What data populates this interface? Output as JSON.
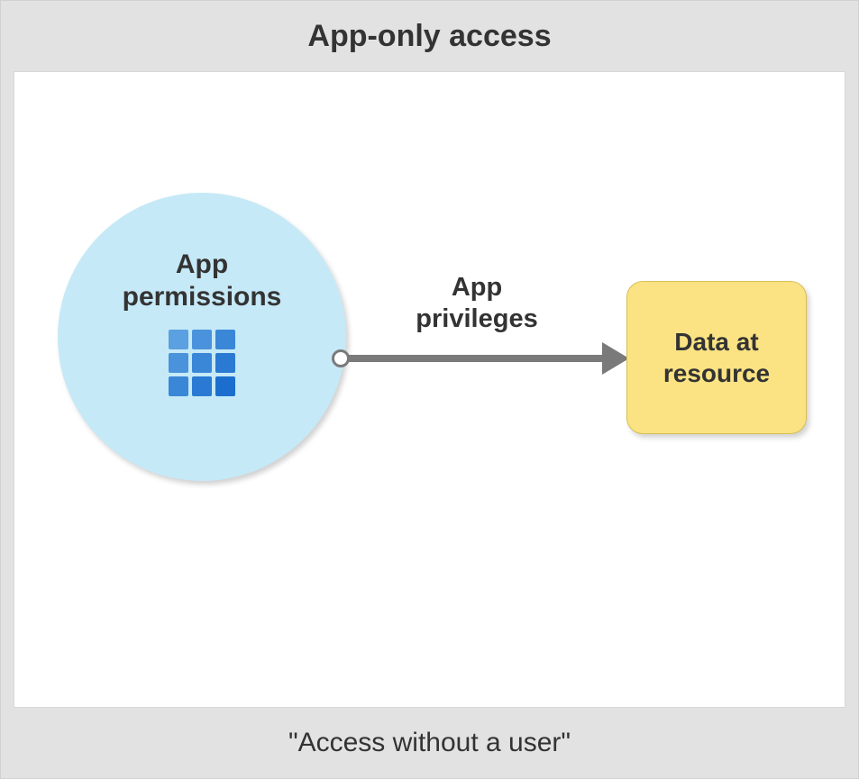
{
  "title": "App-only access",
  "subtitle": "\"Access without a user\"",
  "nodes": {
    "app": {
      "label": "App\npermissions",
      "icon": "app-grid-icon",
      "shape": "circle",
      "color": "#c6e9f7"
    },
    "resource": {
      "label": "Data at\nresource",
      "shape": "rounded-rect",
      "color": "#fbe383"
    }
  },
  "edge": {
    "from": "app",
    "to": "resource",
    "label": "App\nprivileges",
    "color": "#7a7a7a"
  }
}
